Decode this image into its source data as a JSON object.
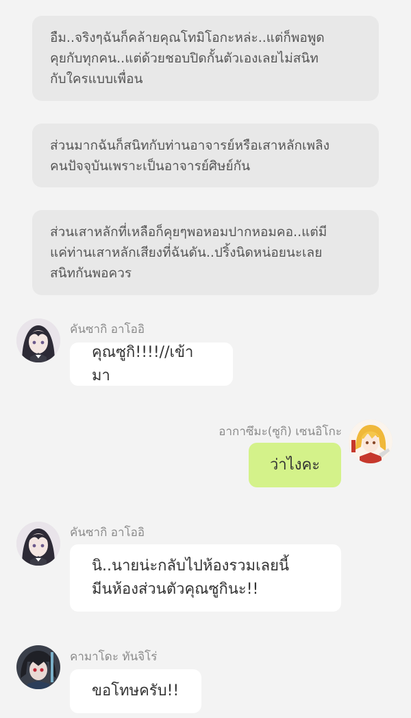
{
  "narrations": [
    {
      "text": "อืม..จริงๆฉันก็คล้ายคุณโทมิโอกะหล่ะ..แต่ก็พอพูด\nคุยกับทุกคน..แต่ด้วยชอบปิดกั้นตัวเองเลยไม่สนิท\nกับใครแบบเพื่อน"
    },
    {
      "text": "ส่วนมากฉันก็สนิทกับท่านอาจารย์หรือเสาหลักเพลิง\nคนปัจจุบันเพราะเป็นอาจารย์ศิษย์กัน"
    },
    {
      "text": "ส่วนเสาหลักที่เหลือก็คุยๆพอหอมปากหอมคอ..แต่มี\nแค่ท่านเสาหลักเสียงที่ฉันดัน..ปริ้งนิดหน่อยนะเลย\nสนิทกันพอควร"
    }
  ],
  "messages": [
    {
      "sender": "คันซากิ อาโออิ",
      "text": "คุณซูกิ!!!!//เข้ามา",
      "side": "left",
      "avatar_icon": "girl-dark-hair-avatar-icon"
    },
    {
      "sender": "อากาซึมะ(ซูกิ) เซนอิโกะ",
      "text": "ว่าไงคะ",
      "side": "right",
      "avatar_icon": "girl-orange-hair-avatar-icon"
    },
    {
      "sender": "คันซากิ อาโออิ",
      "text": "นิ..นายน่ะกลับไปห้องรวมเลยนี้\nมีนห้องส่วนตัวคุณซูกินะ!!",
      "side": "left",
      "avatar_icon": "girl-dark-hair-avatar-icon"
    },
    {
      "sender": "คามาโดะ ทันจิโร่",
      "text": "ขอโทษครับ!!",
      "side": "left",
      "avatar_icon": "boy-red-eyes-avatar-icon"
    }
  ],
  "colors": {
    "background": "#f3f3f3",
    "narration_bg": "#e8e8e8",
    "bubble_left": "#ffffff",
    "bubble_right": "#d4f28a"
  }
}
